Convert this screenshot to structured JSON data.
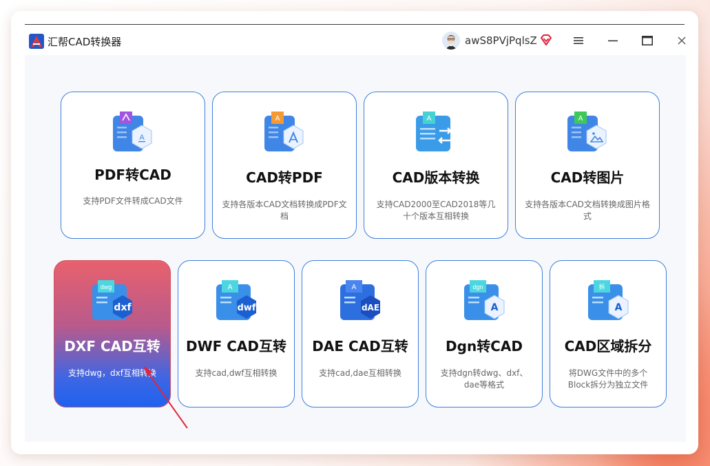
{
  "window": {
    "title": "汇帮CAD转换器",
    "username": "awS8PVjPqlsZ"
  },
  "colors": {
    "accent": "#3d7fd9",
    "active_top": "#e8616d",
    "active_bottom": "#1e62f0"
  },
  "cards": [
    {
      "title": "PDF转CAD",
      "desc": "支持PDF文件转成CAD文件",
      "icon": "pdf-to-cad-icon"
    },
    {
      "title": "CAD转PDF",
      "desc": "支持各版本CAD文档转换成PDF文档",
      "icon": "cad-to-pdf-icon"
    },
    {
      "title": "CAD版本转换",
      "desc": "支持CAD2000至CAD2018等几十个版本互相转换",
      "icon": "cad-version-convert-icon"
    },
    {
      "title": "CAD转图片",
      "desc": "支持各版本CAD文档转换成图片格式",
      "icon": "cad-to-image-icon"
    },
    {
      "title": "DXF CAD互转",
      "desc": "支持dwg，dxf互相转换",
      "icon": "dxf-convert-icon",
      "icon_text": "dxf",
      "icon_top": "dwg"
    },
    {
      "title": "DWF CAD互转",
      "desc": "支持cad,dwf互相转换",
      "icon": "dwf-convert-icon",
      "icon_text": "dwf"
    },
    {
      "title": "DAE CAD互转",
      "desc": "支持cad,dae互相转换",
      "icon": "dae-convert-icon",
      "icon_text": "dAE"
    },
    {
      "title": "Dgn转CAD",
      "desc": "支持dgn转dwg、dxf、dae等格式",
      "icon": "dgn-to-cad-icon",
      "icon_text": "A",
      "icon_top": "dgn"
    },
    {
      "title": "CAD区域拆分",
      "desc": "将DWG文件中的多个Block拆分为独立文件",
      "icon": "cad-split-icon",
      "icon_text": "A",
      "icon_top": "拆"
    }
  ]
}
